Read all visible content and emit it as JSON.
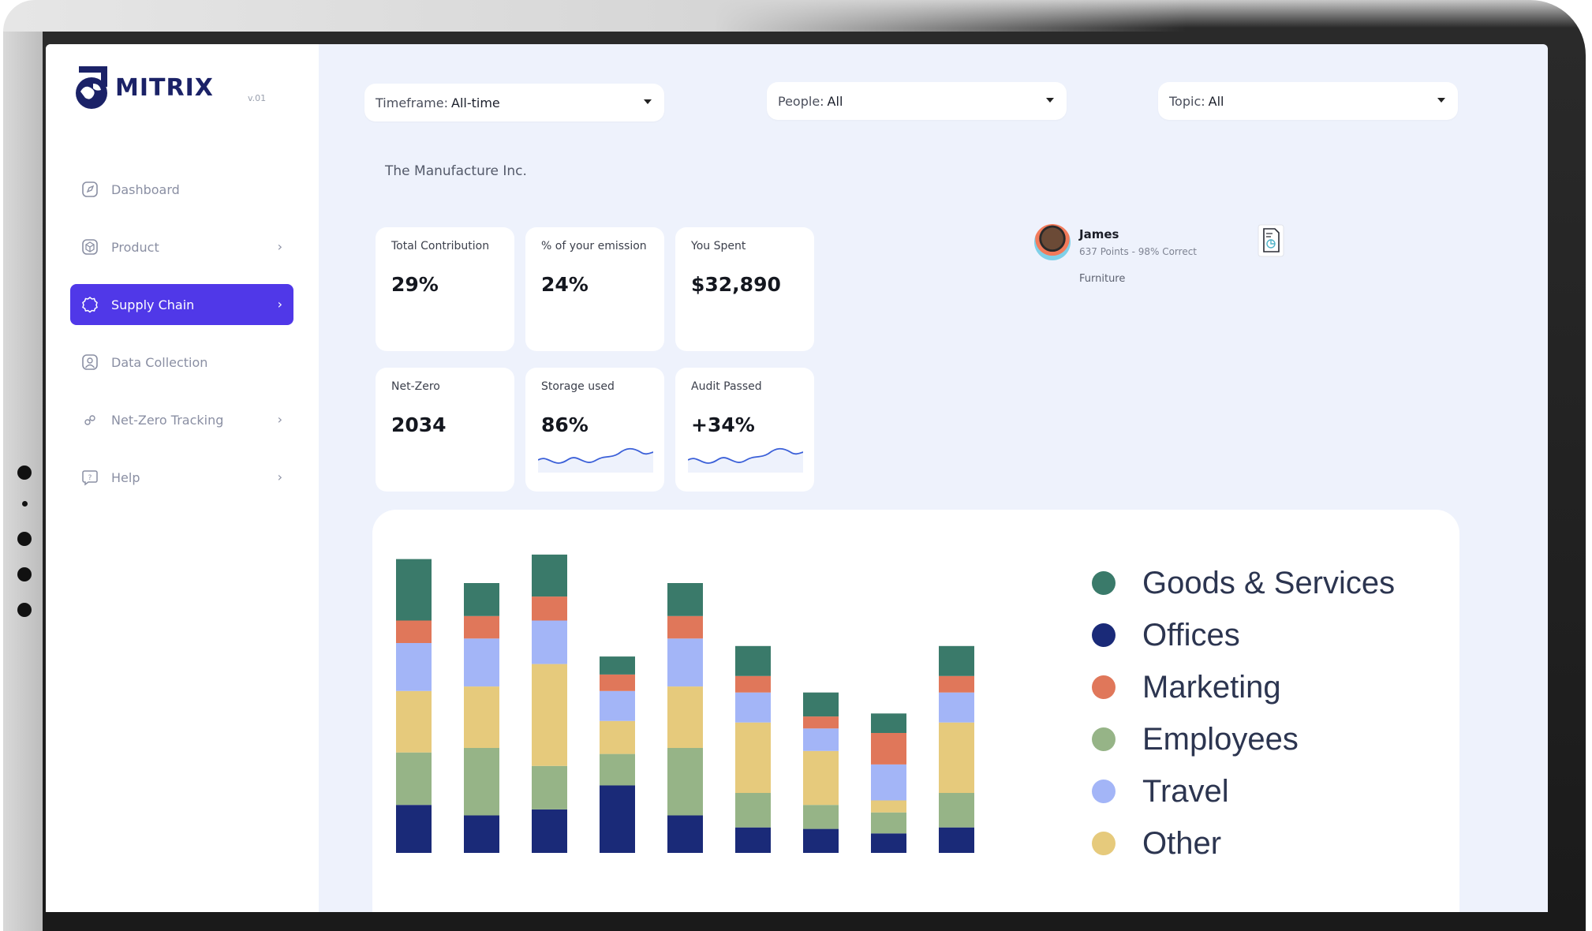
{
  "app": {
    "logo_text": "MITRIX",
    "version": "v.01"
  },
  "sidebar": {
    "items": [
      {
        "label": "Dashboard",
        "icon": "dashboard-icon",
        "has_chevron": false,
        "active": false
      },
      {
        "label": "Product",
        "icon": "box-icon",
        "has_chevron": true,
        "active": false
      },
      {
        "label": "Supply Chain",
        "icon": "gear-icon",
        "has_chevron": true,
        "active": true
      },
      {
        "label": "Data Collection",
        "icon": "user-icon",
        "has_chevron": false,
        "active": false
      },
      {
        "label": "Net-Zero Tracking",
        "icon": "link-icon",
        "has_chevron": true,
        "active": false
      },
      {
        "label": "Help",
        "icon": "help-icon",
        "has_chevron": true,
        "active": false
      }
    ]
  },
  "filters": {
    "timeframe": {
      "label": "Timeframe:",
      "value": "All-time"
    },
    "people": {
      "label": "People:",
      "value": "All"
    },
    "topic": {
      "label": "Topic:",
      "value": "All"
    }
  },
  "company": "The Manufacture Inc.",
  "stats": {
    "total_contribution": {
      "label": "Total Contribution",
      "value": "29%"
    },
    "emission": {
      "label": "% of your emission",
      "value": "24%"
    },
    "spent": {
      "label": "You Spent",
      "value": "$32,890"
    },
    "net_zero": {
      "label": "Net-Zero",
      "value": "2034"
    },
    "storage": {
      "label": "Storage used",
      "value": "86%"
    },
    "audit": {
      "label": "Audit Passed",
      "value": "+34%"
    }
  },
  "profile": {
    "name": "James",
    "subtitle": "637 Points - 98% Correct",
    "tag": "Furniture"
  },
  "colors": {
    "accent": "#5038e8",
    "background": "#eef2fc"
  },
  "chart_data": {
    "type": "bar",
    "stacked": true,
    "title": "",
    "xlabel": "",
    "ylabel": "",
    "categories": [
      "",
      "",
      "",
      "",
      "",
      "",
      "",
      "",
      ""
    ],
    "ylim": [
      0,
      100
    ],
    "series": [
      {
        "name": "Offices",
        "color": "#1a2a78",
        "values": [
          16,
          12.5,
          14.5,
          22.5,
          12.5,
          8.5,
          8,
          6.5,
          8.5
        ]
      },
      {
        "name": "Employees",
        "color": "#96b487",
        "values": [
          17.5,
          22.5,
          14.5,
          10.5,
          22.5,
          11.5,
          8,
          7,
          11.5
        ]
      },
      {
        "name": "Other",
        "color": "#e6ca7c",
        "values": [
          20.5,
          20.5,
          34,
          11,
          20.5,
          23.5,
          18,
          4,
          23.5
        ]
      },
      {
        "name": "Travel",
        "color": "#a3b5f7",
        "values": [
          16,
          16,
          14.5,
          10,
          16,
          10,
          7.5,
          12,
          10
        ]
      },
      {
        "name": "Marketing",
        "color": "#e0775a",
        "values": [
          7.5,
          7.5,
          8,
          5.5,
          7.5,
          5.5,
          4,
          10.5,
          5.5
        ]
      },
      {
        "name": "Goods & Services",
        "color": "#3a7a6a",
        "values": [
          20.5,
          11,
          14,
          6,
          11,
          10,
          8,
          6.5,
          10
        ]
      }
    ]
  },
  "legend": [
    {
      "name": "Goods & Services",
      "color": "#3a7a6a"
    },
    {
      "name": "Offices",
      "color": "#1a2a78"
    },
    {
      "name": "Marketing",
      "color": "#e0775a"
    },
    {
      "name": "Employees",
      "color": "#96b487"
    },
    {
      "name": "Travel",
      "color": "#a3b5f7"
    },
    {
      "name": "Other",
      "color": "#e6ca7c"
    }
  ]
}
